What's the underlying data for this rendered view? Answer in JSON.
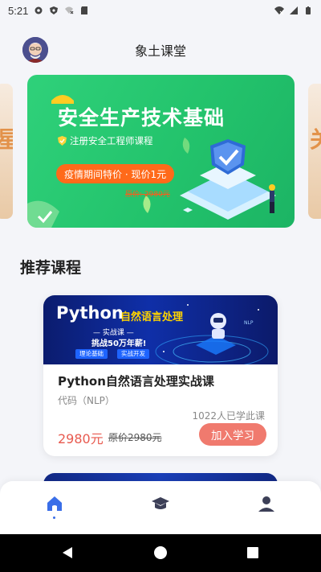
{
  "status_bar": {
    "time": "5:21",
    "icons": [
      "settings-icon",
      "shield-icon",
      "no-data-icon",
      "sd-card-icon",
      "wifi-icon",
      "signal-icon",
      "battery-icon"
    ]
  },
  "header": {
    "title": "象土课堂",
    "avatar": "user-avatar"
  },
  "banner": {
    "title": "安全生产技术基础",
    "subtitle": "注册安全工程师课程",
    "promo": "疫情期间特价 · 现价1元",
    "old_price": "原价: 2980元",
    "colors": {
      "bg": "#23c36c",
      "promo": "#ff6a1a"
    }
  },
  "section": {
    "title": "推荐课程"
  },
  "courses": [
    {
      "image": {
        "headline": "Python",
        "headline_suffix": "自然语言处理",
        "subtitle": "— 实战课 —",
        "challenge": "挑战50万年薪!",
        "tags": [
          "理论基础",
          "实战开发"
        ]
      },
      "name": "Python自然语言处理实战课",
      "tag": "代码（NLP）",
      "learners": "1022人已学此课",
      "price": "2980元",
      "original_price": "原价2980元",
      "action": "加入学习"
    }
  ],
  "bottom_nav": {
    "items": [
      "home-icon",
      "courses-icon",
      "profile-icon"
    ],
    "active": "home-icon",
    "colors": {
      "active": "#3a6ee8",
      "inactive": "#3c3f57"
    }
  },
  "system_nav": {
    "buttons": [
      "back-icon",
      "home-circle-icon",
      "recents-icon"
    ]
  },
  "colors": {
    "accent_red": "#e85a4f",
    "button_bg": "#f07a6e",
    "page_bg": "#f4f5f9"
  }
}
